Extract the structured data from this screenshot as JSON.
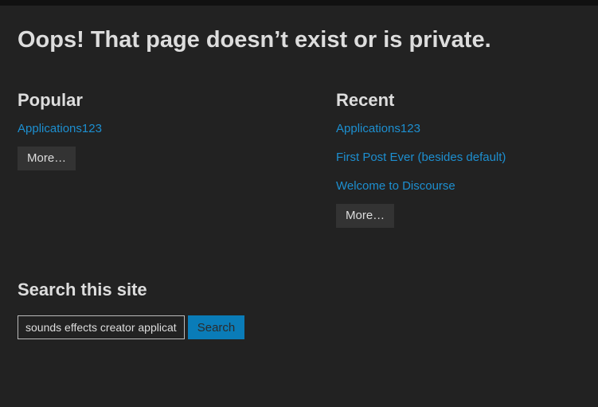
{
  "header": {
    "title": "Oops! That page doesn’t exist or is private."
  },
  "popular": {
    "heading": "Popular",
    "links": [
      "Applications123"
    ],
    "more_label": "More…"
  },
  "recent": {
    "heading": "Recent",
    "links": [
      "Applications123",
      "First Post Ever (besides default)",
      "Welcome to Discourse"
    ],
    "more_label": "More…"
  },
  "search": {
    "heading": "Search this site",
    "value": "sounds effects creator applications",
    "button_label": "Search"
  },
  "colors": {
    "background": "#222222",
    "link": "#1d8fd0",
    "primary_button": "#0a7cb8"
  }
}
